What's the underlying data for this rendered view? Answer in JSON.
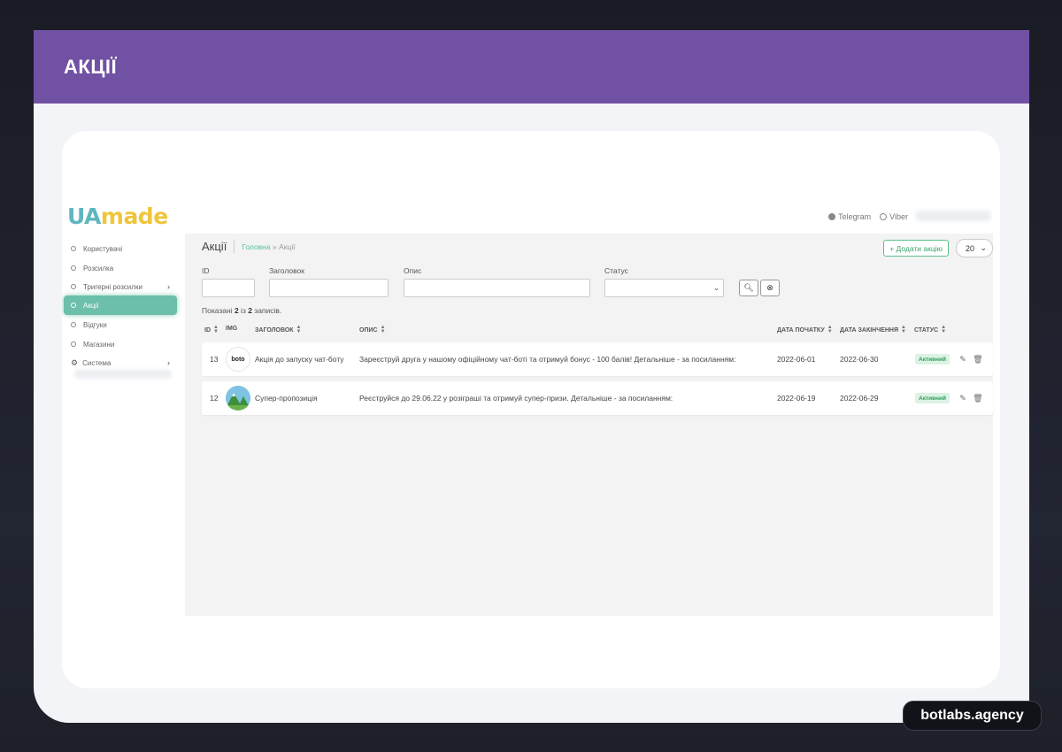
{
  "banner": {
    "title": "АКЦІЇ"
  },
  "logo": {
    "part1": "UA",
    "part2": "made"
  },
  "top_links": {
    "telegram": "Telegram",
    "viber": "Viber"
  },
  "sidebar": {
    "items": [
      {
        "label": "Користувачі"
      },
      {
        "label": "Розсилка"
      },
      {
        "label": "Тригерні розсилки"
      },
      {
        "label": "Акції"
      },
      {
        "label": "Відгуки"
      },
      {
        "label": "Магазини"
      },
      {
        "label": "Система"
      }
    ]
  },
  "page": {
    "title": "Акції",
    "breadcrumb_home": "Головна",
    "breadcrumb_sep": "»",
    "breadcrumb_current": "Акції",
    "add_button": "+ Додати акцію",
    "per_page": "20"
  },
  "filters": {
    "id": "ID",
    "title": "Заголовок",
    "desc": "Опис",
    "status": "Статус"
  },
  "summary": {
    "prefix": "Показані ",
    "shown": "2",
    "middle": " із ",
    "total": "2",
    "suffix": " записів."
  },
  "table": {
    "headers": {
      "id": "ID",
      "img": "IMG",
      "title": "ЗАГОЛОВОК",
      "desc": "ОПИС",
      "start": "ДАТА ПОЧАТКУ",
      "end": "ДАТА ЗАКІНЧЕННЯ",
      "status": "СТАТУС"
    },
    "rows": [
      {
        "id": "13",
        "img_label": "boto",
        "title": "Акція до запуску чат-боту",
        "desc": "Зареєструй друга у нашому офіційному чат-боті та отримуй бонус - 100 балів! Детальніше - за посиланням:",
        "start": "2022-06-01",
        "end": "2022-06-30",
        "status": "Активний"
      },
      {
        "id": "12",
        "img_label": "",
        "title": "Супер-пропозиція",
        "desc": "Реєструйся до 29.06.22 у розіграші та отримуй супер-призи. Детальніше - за посиланням:",
        "start": "2022-06-19",
        "end": "2022-06-29",
        "status": "Активний"
      }
    ]
  },
  "brand": {
    "label": "botlabs.agency"
  },
  "colors": {
    "banner": "#7151a3",
    "accent": "#6cbfaa",
    "active_badge": "#2e9e5a"
  }
}
